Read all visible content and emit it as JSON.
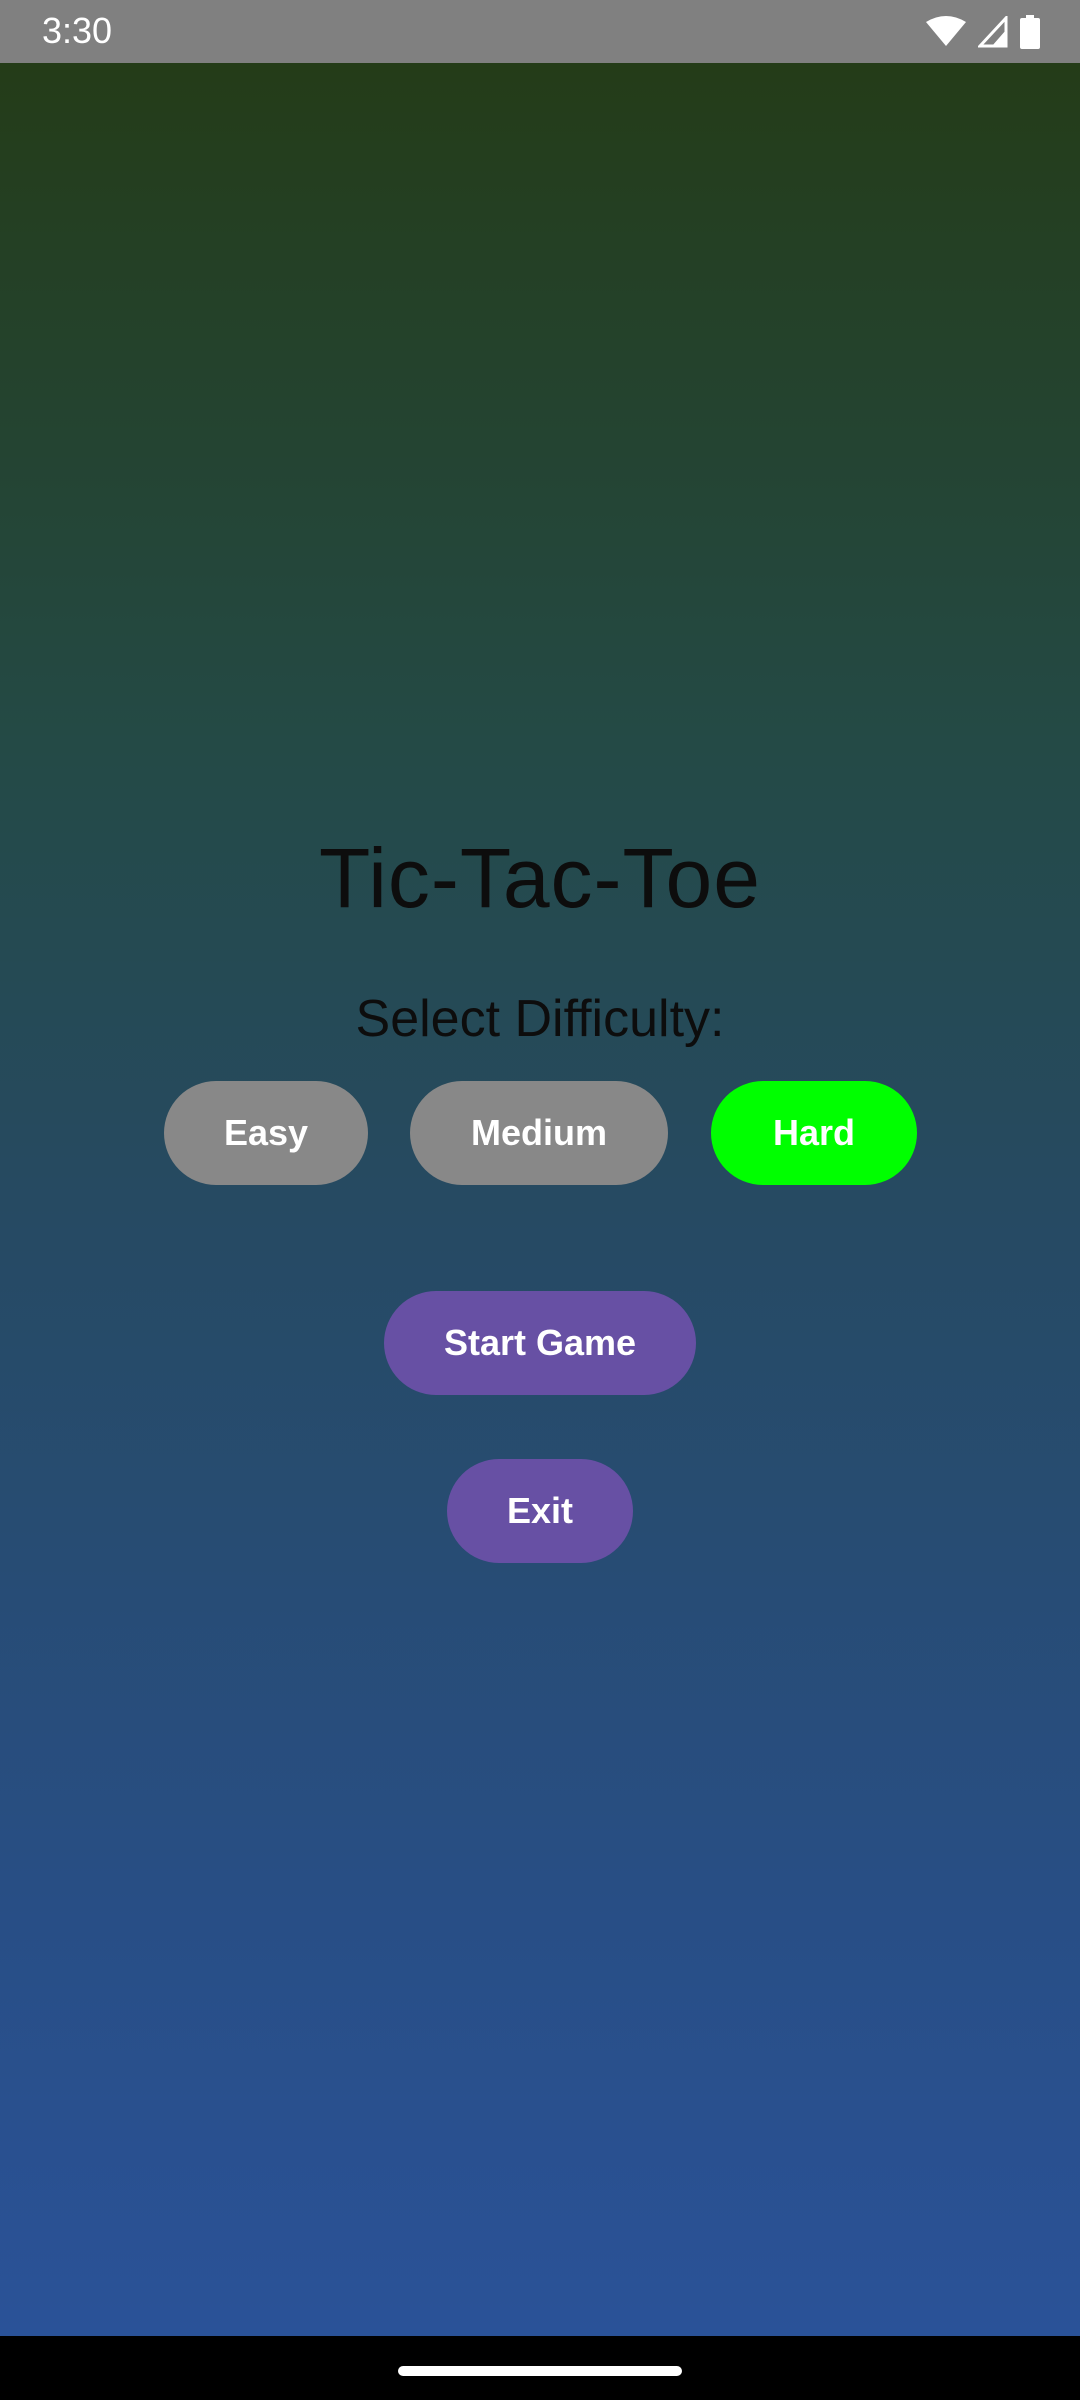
{
  "status_bar": {
    "time": "3:30",
    "icons": [
      "wifi-icon",
      "signal-icon",
      "battery-icon"
    ]
  },
  "app": {
    "title": "Tic-Tac-Toe",
    "difficulty_label": "Select Difficulty:",
    "difficulties": [
      {
        "label": "Easy",
        "selected": false
      },
      {
        "label": "Medium",
        "selected": false
      },
      {
        "label": "Hard",
        "selected": true
      }
    ],
    "start_label": "Start Game",
    "exit_label": "Exit"
  },
  "colors": {
    "selected": "#00ff00",
    "unselected": "#888888",
    "primary": "#6750a4",
    "gradient_top": "#243c18",
    "gradient_bottom": "#2a5298"
  }
}
